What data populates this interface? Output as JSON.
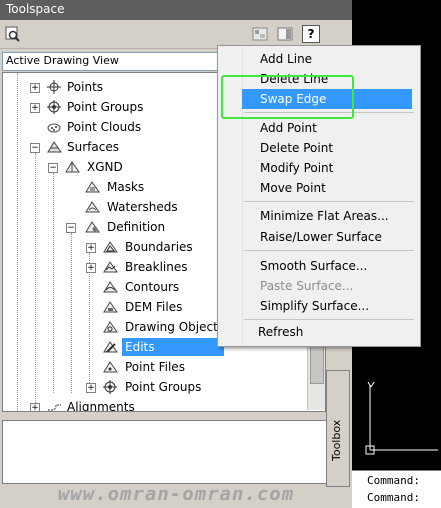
{
  "window": {
    "title": "Toolspace"
  },
  "toolbar": {
    "icons": [
      "search-icon",
      "settings-icon",
      "panel-icon",
      "help-icon"
    ],
    "help_label": "?"
  },
  "view_select": {
    "value": "Active Drawing View"
  },
  "tree": {
    "items": [
      {
        "label": "Points",
        "icon": "points-icon"
      },
      {
        "label": "Point Groups",
        "icon": "point-groups-icon"
      },
      {
        "label": "Point Clouds",
        "icon": "point-clouds-icon"
      },
      {
        "label": "Surfaces",
        "icon": "surfaces-icon"
      },
      {
        "label": "XGND",
        "icon": "surface-icon"
      },
      {
        "label": "Masks",
        "icon": "masks-icon"
      },
      {
        "label": "Watersheds",
        "icon": "watersheds-icon"
      },
      {
        "label": "Definition",
        "icon": "definition-icon"
      },
      {
        "label": "Boundaries",
        "icon": "boundaries-icon"
      },
      {
        "label": "Breaklines",
        "icon": "breaklines-icon"
      },
      {
        "label": "Contours",
        "icon": "contours-icon"
      },
      {
        "label": "DEM Files",
        "icon": "dem-files-icon"
      },
      {
        "label": "Drawing Objects",
        "icon": "drawing-objects-icon"
      },
      {
        "label": "Edits",
        "icon": "edits-icon"
      },
      {
        "label": "Point Files",
        "icon": "point-files-icon"
      },
      {
        "label": "Point Groups",
        "icon": "point-groups-icon"
      },
      {
        "label": "Alignments",
        "icon": "alignments-icon"
      }
    ]
  },
  "context_menu": {
    "items": [
      {
        "label": "Add Line",
        "disabled": false,
        "highlighted": false
      },
      {
        "label": "Delete Line",
        "disabled": false,
        "highlighted": false
      },
      {
        "label": "Swap Edge",
        "disabled": false,
        "highlighted": true
      },
      {
        "label": "Add Point",
        "disabled": false,
        "highlighted": false
      },
      {
        "label": "Delete Point",
        "disabled": false,
        "highlighted": false
      },
      {
        "label": "Modify Point",
        "disabled": false,
        "highlighted": false
      },
      {
        "label": "Move Point",
        "disabled": false,
        "highlighted": false
      },
      {
        "label": "Minimize Flat Areas...",
        "disabled": false,
        "highlighted": false
      },
      {
        "label": "Raise/Lower Surface",
        "disabled": false,
        "highlighted": false
      },
      {
        "label": "Smooth Surface...",
        "disabled": false,
        "highlighted": false
      },
      {
        "label": "Paste Surface...",
        "disabled": true,
        "highlighted": false
      },
      {
        "label": "Simplify Surface...",
        "disabled": false,
        "highlighted": false
      },
      {
        "label": "Refresh",
        "disabled": false,
        "highlighted": false
      }
    ]
  },
  "toolbox": {
    "label": "Toolbox"
  },
  "command_line": {
    "lines": [
      "Command: ",
      "Command: "
    ]
  },
  "watermark": {
    "text": "www.omran-omran.com"
  },
  "colors": {
    "highlight": "#3399ff",
    "annotation": "#3ee83e",
    "titlebar": "#5e5e5e"
  }
}
